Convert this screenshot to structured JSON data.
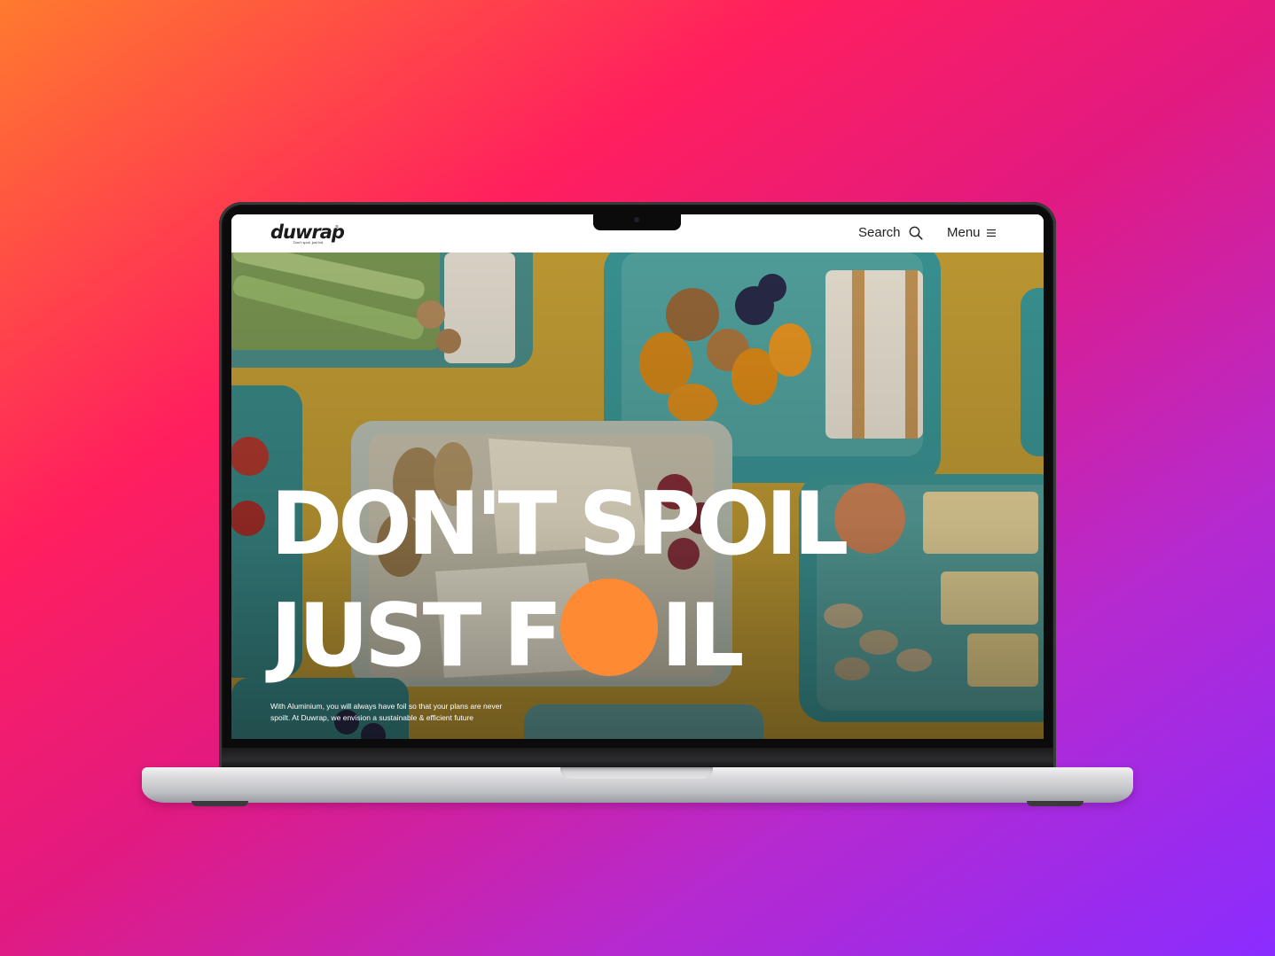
{
  "site": {
    "logo": "duwrap",
    "logo_tagline": "Don't spoil, just foil",
    "logo_mark": "®",
    "nav": {
      "search_label": "Search",
      "menu_label": "Menu",
      "search_icon": "search-icon",
      "menu_icon": "hamburger-icon"
    }
  },
  "hero": {
    "headline_line1": "DON'T SPOIL",
    "headline_line2_start": "JUST F",
    "headline_line2_end": "IL",
    "description": "With Aluminium, you will always have foil so that your plans are never spoilt. At Duwrap, we envision a sustainable & efficient future",
    "accent_color": "#ff8a34"
  }
}
